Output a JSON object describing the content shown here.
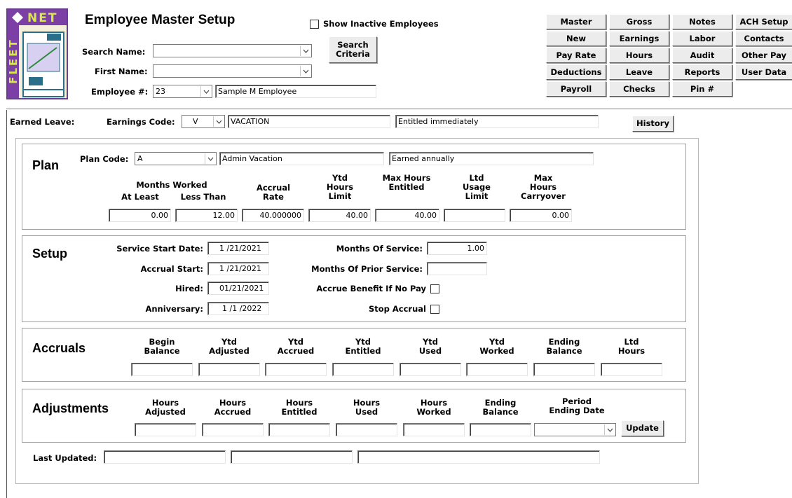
{
  "header": {
    "title": "Employee Master Setup",
    "show_inactive_label": "Show Inactive Employees",
    "search_name_label": "Search Name:",
    "search_name_value": "",
    "first_name_label": "First Name:",
    "first_name_value": "",
    "employee_no_label": "Employee #:",
    "employee_no_value": "23",
    "employee_name_value": "Sample M Employee",
    "search_criteria_label": "Search\nCriteria"
  },
  "logo": {
    "text_top": "NET",
    "text_side": "FLEET"
  },
  "nav": {
    "col1": [
      "Master",
      "New",
      "Pay Rate",
      "Deductions",
      "Payroll"
    ],
    "col2": [
      "Gross",
      "Earnings",
      "Hours",
      "Leave",
      "Checks"
    ],
    "col3": [
      "Notes",
      "Labor",
      "Audit",
      "Reports",
      "Pin #"
    ],
    "col4": [
      "ACH Setup",
      "Contacts",
      "Other Pay",
      "User Data"
    ]
  },
  "earned": {
    "label": "Earned Leave:",
    "code_label": "Earnings Code:",
    "code_value": "V",
    "code_desc": "VACATION",
    "entitlement": "Entitled immediately",
    "history_label": "History"
  },
  "plan": {
    "title": "Plan",
    "code_label": "Plan Code:",
    "code_value": "A",
    "desc": "Admin Vacation",
    "freq": "Earned annually",
    "months_worked_label": "Months Worked",
    "at_least_label": "At Least",
    "less_than_label": "Less Than",
    "accrual_rate_label": "Accrual\nRate",
    "ytd_hours_limit_label": "Ytd\nHours\nLimit",
    "max_hours_entitled_label": "Max Hours\nEntitled",
    "ltd_usage_limit_label": "Ltd\nUsage\nLimit",
    "max_hours_carryover_label": "Max\nHours\nCarryover",
    "at_least": "0.00",
    "less_than": "12.00",
    "accrual_rate": "40.000000",
    "ytd_hours_limit": "40.00",
    "max_hours_entitled": "40.00",
    "ltd_usage_limit": "",
    "max_hours_carryover": "0.00"
  },
  "setup": {
    "title": "Setup",
    "service_start_label": "Service Start Date:",
    "service_start": "1 /21/2021",
    "accrual_start_label": "Accrual Start:",
    "accrual_start": "1 /21/2021",
    "hired_label": "Hired:",
    "hired": "01/21/2021",
    "anniversary_label": "Anniversary:",
    "anniversary": "1 /1 /2022",
    "months_service_label": "Months Of Service:",
    "months_service": "1.00",
    "months_prior_label": "Months Of Prior Service:",
    "months_prior": "",
    "accrue_no_pay_label": "Accrue Benefit If No Pay",
    "stop_accrual_label": "Stop Accrual"
  },
  "accruals": {
    "title": "Accruals",
    "columns": [
      "Begin\nBalance",
      "Ytd\nAdjusted",
      "Ytd\nAccrued",
      "Ytd\nEntitled",
      "Ytd\nUsed",
      "Ytd\nWorked",
      "Ending\nBalance",
      "Ltd\nHours"
    ],
    "values": [
      "",
      "",
      "",
      "",
      "",
      "",
      "",
      ""
    ]
  },
  "adjustments": {
    "title": "Adjustments",
    "columns": [
      "Hours\nAdjusted",
      "Hours\nAccrued",
      "Hours\nEntitled",
      "Hours\nUsed",
      "Hours\nWorked",
      "Ending\nBalance"
    ],
    "values": [
      "",
      "",
      "",
      "",
      "",
      ""
    ],
    "period_label": "Period\nEnding Date",
    "period_value": "",
    "update_label": "Update"
  },
  "footer": {
    "last_updated_label": "Last Updated:",
    "v1": "",
    "v2": "",
    "v3": ""
  }
}
